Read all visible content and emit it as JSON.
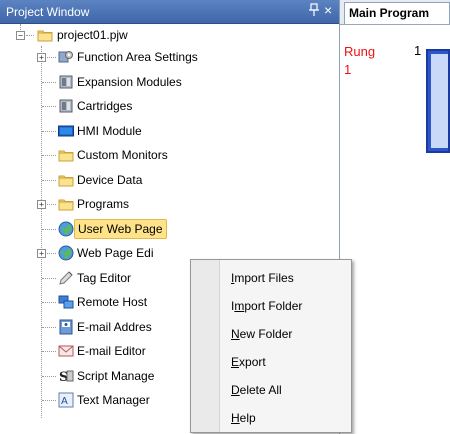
{
  "window": {
    "title": "Project Window",
    "pin_glyph": "p",
    "close_glyph": "×"
  },
  "tree": {
    "root": {
      "label": "project01.pjw",
      "icon": "folder-icon",
      "expander": "−"
    },
    "items": [
      {
        "label": "Function Area Settings",
        "icon": "settings-icon",
        "expander": "+"
      },
      {
        "label": "Expansion Modules",
        "icon": "module-icon",
        "expander": ""
      },
      {
        "label": "Cartridges",
        "icon": "cartridge-icon",
        "expander": ""
      },
      {
        "label": "HMI Module",
        "icon": "hmi-icon",
        "expander": ""
      },
      {
        "label": "Custom Monitors",
        "icon": "folder-icon",
        "expander": ""
      },
      {
        "label": "Device Data",
        "icon": "folder-icon",
        "expander": ""
      },
      {
        "label": "Programs",
        "icon": "folder-icon",
        "expander": "+"
      },
      {
        "label": "User Web Page",
        "icon": "globe-icon",
        "expander": "",
        "selected": true
      },
      {
        "label": "Web Page Edi",
        "icon": "globe-icon",
        "expander": "+"
      },
      {
        "label": "Tag Editor",
        "icon": "tag-icon",
        "expander": ""
      },
      {
        "label": "Remote Host",
        "icon": "remote-host-icon",
        "expander": ""
      },
      {
        "label": "E-mail Addres",
        "icon": "address-book-icon",
        "expander": ""
      },
      {
        "label": "E-mail Editor",
        "icon": "email-icon",
        "expander": ""
      },
      {
        "label": "Script Manage",
        "icon": "script-icon",
        "expander": ""
      },
      {
        "label": "Text Manager",
        "icon": "text-manager-icon",
        "expander": ""
      }
    ]
  },
  "editor": {
    "tab_label": "Main Program",
    "rung_label": "Rung",
    "rung_index": "1",
    "rung_number": "1"
  },
  "context_menu": {
    "items": [
      {
        "pre": "",
        "key": "I",
        "post": "mport Files"
      },
      {
        "pre": "I",
        "key": "m",
        "post": "port Folder"
      },
      {
        "pre": "",
        "key": "N",
        "post": "ew Folder"
      },
      {
        "pre": "",
        "key": "E",
        "post": "xport"
      },
      {
        "pre": "",
        "key": "D",
        "post": "elete All"
      },
      {
        "pre": "",
        "key": "H",
        "post": "elp"
      }
    ]
  },
  "colors": {
    "titlebar": "#4a72b5",
    "rung_label": "#e11111",
    "selection": "#ffe38a",
    "rung_block": "#2e56c8"
  }
}
